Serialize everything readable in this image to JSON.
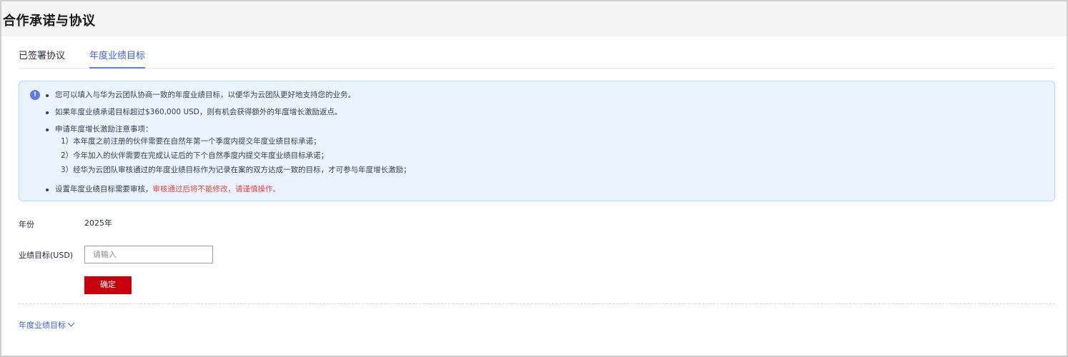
{
  "header": {
    "title": "合作承诺与协议"
  },
  "tabs": [
    {
      "label": "已签署协议",
      "active": false
    },
    {
      "label": "年度业绩目标",
      "active": true
    }
  ],
  "notice": {
    "icon": "info-icon",
    "line1": "您可以填入与华为云团队协商一致的年度业绩目标，以便华为云团队更好地支持您的业务。",
    "line2": "如果年度业绩承诺目标超过$360,000 USD，则有机会获得额外的年度增长激励返点。",
    "line3": "申请年度增长激励注意事项：",
    "sub1": "1）本年度之前注册的伙伴需要在自然年第一个季度内提交年度业绩目标承诺；",
    "sub2": "2）今年加入的伙伴需要在完成认证后的下个自然季度内提交年度业绩目标承诺；",
    "sub3": "3）经华为云团队审核通过的年度业绩目标作为记录在案的双方达成一致的目标，才可参与年度增长激励；",
    "line4_normal": "设置年度业绩目标需要审核，",
    "line4_red": "审核通过后将不能修改，请谨慎操作。"
  },
  "form": {
    "year_label": "年份",
    "year_value": "2025年",
    "target_label": "业绩目标(USD)",
    "target_value": "",
    "target_placeholder": "请输入",
    "confirm_label": "确定"
  },
  "history": {
    "toggle_label": "年度业绩目标",
    "icon": "chevron-down-icon"
  },
  "colors": {
    "accent": "#5e7ce0",
    "primary_button": "#c7000b",
    "warning_text": "#e54545",
    "notice_bg": "#eaf4fe"
  }
}
